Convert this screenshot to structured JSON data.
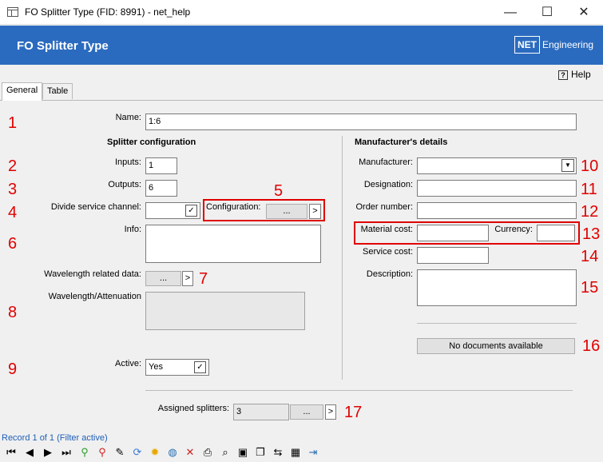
{
  "window": {
    "title": "FO Splitter Type (FID: 8991) - net_help",
    "minimize": "—",
    "maximize": "☐",
    "close": "✕"
  },
  "header": {
    "title": "FO Splitter Type",
    "logo_net": "NET",
    "logo_engineering": "Engineering",
    "accent_color": "#2b6bbf"
  },
  "help": {
    "icon": "?",
    "label": "Help"
  },
  "tabs": [
    {
      "label": "General",
      "active": true
    },
    {
      "label": "Table",
      "active": false
    }
  ],
  "form": {
    "name_label": "Name:",
    "name_value": "1:6",
    "splitter_heading": "Splitter configuration",
    "inputs_label": "Inputs:",
    "inputs_value": "1",
    "outputs_label": "Outputs:",
    "outputs_value": "6",
    "divide_label": "Divide service channel:",
    "divide_check": "✓",
    "configuration_label": "Configuration:",
    "ellipsis": "...",
    "arrow": ">",
    "info_label": "Info:",
    "wavelength_data_label": "Wavelength related data:",
    "wavelength_att_label": "Wavelength/Attenuation",
    "active_label": "Active:",
    "active_value": "Yes",
    "active_check": "✓",
    "manufacturer_heading": "Manufacturer's details",
    "manufacturer_label": "Manufacturer:",
    "dropdown_glyph": "▼",
    "designation_label": "Designation:",
    "order_label": "Order number:",
    "material_label": "Material cost:",
    "currency_label": "Currency:",
    "service_label": "Service cost:",
    "description_label": "Description:",
    "documents_button": "No documents available",
    "assigned_label": "Assigned splitters:",
    "assigned_value": "3"
  },
  "annotations": [
    "1",
    "2",
    "3",
    "4",
    "5",
    "6",
    "7",
    "8",
    "9",
    "10",
    "11",
    "12",
    "13",
    "14",
    "15",
    "16",
    "17"
  ],
  "status": {
    "record_text": "Record 1 of 1 (Filter active)"
  },
  "toolbar": {
    "icons": [
      "first-record-icon",
      "prev-record-icon",
      "next-record-icon",
      "last-record-icon",
      "add-filter-icon",
      "remove-filter-icon",
      "edit-icon",
      "refresh-icon",
      "highlight-icon",
      "globe-icon",
      "delete-icon",
      "print-icon",
      "search-icon",
      "select-icon",
      "copy-icon",
      "link-icon",
      "table-edit-icon",
      "exit-icon"
    ],
    "glyphs": [
      "⏮",
      "◀",
      "▶",
      "⏭",
      "⚲",
      "⚲",
      "✎",
      "⟳",
      "✹",
      "◍",
      "✕",
      "⎙",
      "⌕",
      "▣",
      "❐",
      "⇆",
      "▦",
      "⇥"
    ]
  }
}
